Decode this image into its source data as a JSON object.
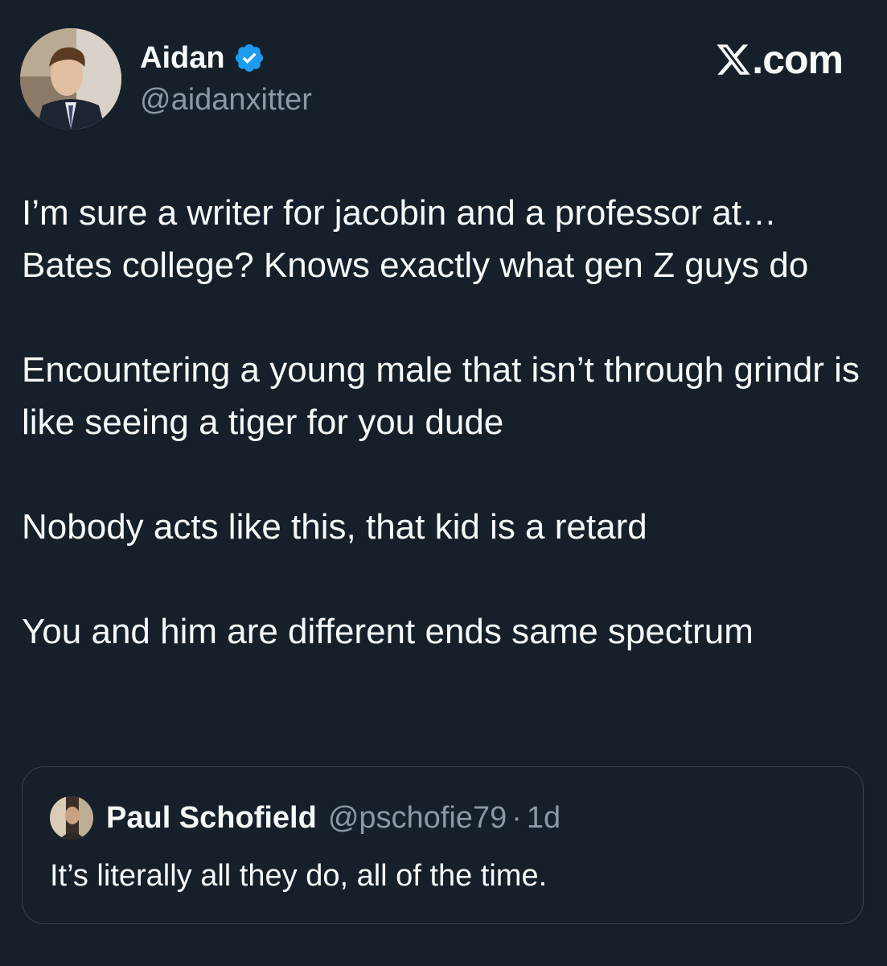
{
  "author": {
    "display_name": "Aidan",
    "handle": "@aidanxitter",
    "verified": true,
    "avatar": "profile-photo"
  },
  "brand": {
    "logo_icon": "x-logo-icon",
    "suffix": ".com"
  },
  "tweet": {
    "paragraphs": [
      "I’m sure a writer for jacobin and a professor at… Bates college? Knows exactly what gen Z guys do",
      "Encountering a young male that isn’t through grindr is like seeing a tiger for you dude",
      "Nobody acts like this, that kid is a retard",
      "You and him are different ends same spectrum"
    ]
  },
  "quoted_tweet": {
    "display_name": "Paul Schofield",
    "handle": "@pschofie79",
    "separator": "·",
    "time": "1d",
    "text": "It’s literally all they do, all of the time."
  },
  "colors": {
    "background": "#15202b",
    "text": "#f7f9f9",
    "secondary_text": "#8b98a5",
    "verified": "#1d9bf0",
    "border": "#38444d"
  }
}
